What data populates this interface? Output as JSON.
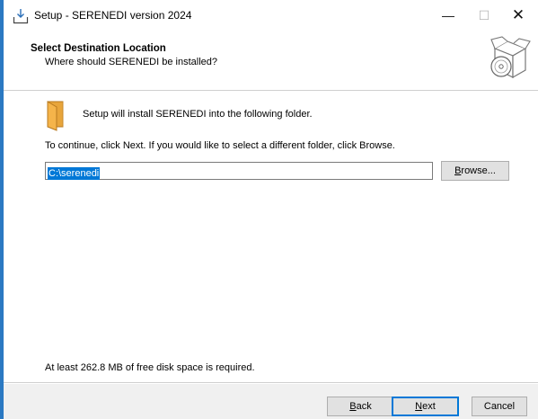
{
  "window": {
    "title": "Setup - SERENEDI version 2024",
    "controls": {
      "minimize": "—",
      "maximize": "☐",
      "close": "✕"
    }
  },
  "header": {
    "title": "Select Destination Location",
    "subtitle": "Where should SERENEDI be installed?"
  },
  "body": {
    "intro": "Setup will install SERENEDI into the following folder.",
    "instruction": "To continue, click Next. If you would like to select a different folder, click Browse.",
    "path_value": "C:\\serenedi",
    "browse": {
      "accel": "B",
      "rest": "rowse..."
    },
    "disk_space": "At least 262.8 MB of free disk space is required."
  },
  "footer": {
    "back": {
      "accel": "B",
      "rest": "ack"
    },
    "next": {
      "accel": "N",
      "rest": "ext"
    },
    "cancel": "Cancel"
  },
  "colors": {
    "accent": "#0078d7",
    "window_edge": "#2b79c2",
    "folder": "#f5b44a",
    "footer_bg": "#f0f0f0",
    "button_bg": "#e1e1e1"
  },
  "icons": {
    "title": "setup-download-icon",
    "header": "software-box-icon",
    "folder": "folder-icon"
  }
}
